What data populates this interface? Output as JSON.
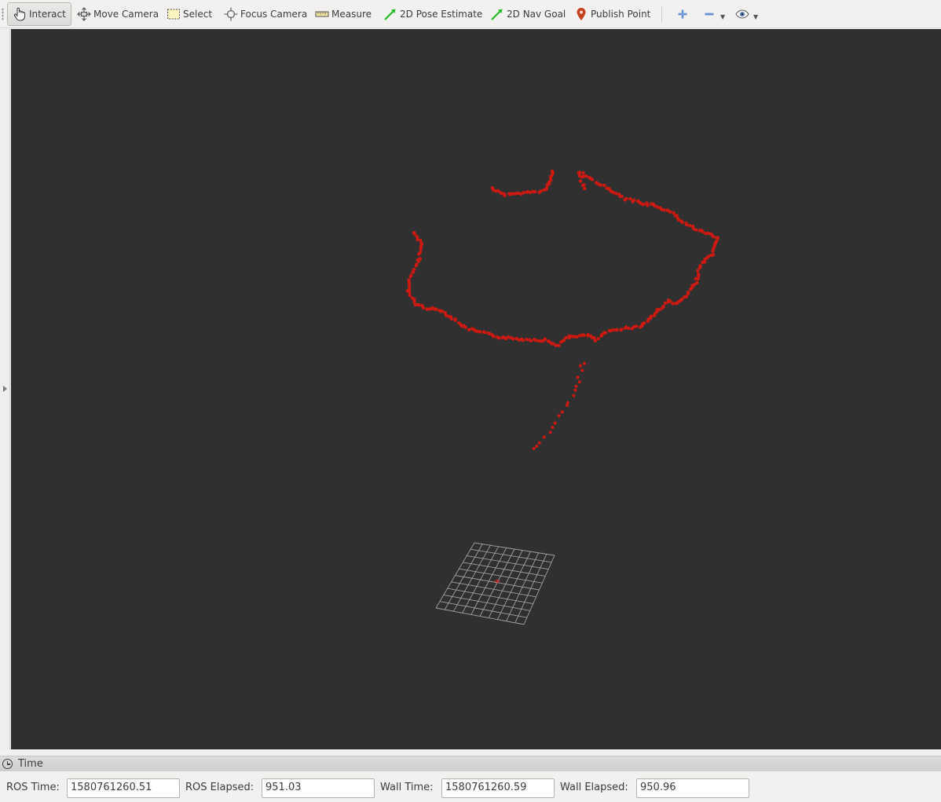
{
  "toolbar": {
    "tools": [
      {
        "label": "Interact",
        "icon": "hand-pointer-icon",
        "active": true
      },
      {
        "label": "Move Camera",
        "icon": "move-camera-icon"
      },
      {
        "label": "Select",
        "icon": "select-rectangle-icon"
      },
      {
        "label": "Focus Camera",
        "icon": "focus-camera-icon"
      },
      {
        "label": "Measure",
        "icon": "ruler-icon"
      },
      {
        "label": "2D Pose Estimate",
        "icon": "green-arrow-icon"
      },
      {
        "label": "2D Nav Goal",
        "icon": "green-arrow-icon"
      },
      {
        "label": "Publish Point",
        "icon": "map-pin-icon"
      }
    ],
    "extra_icons": [
      "add-tool-icon",
      "remove-tool-icon",
      "view-eye-icon"
    ]
  },
  "viewport": {
    "background": "#303030",
    "pointcloud_color": "#cc1a12",
    "grid_color": "#a0a0a0"
  },
  "time_panel": {
    "title": "Time",
    "ros_time_label": "ROS Time:",
    "ros_time_value": "1580761260.51",
    "ros_elapsed_label": "ROS Elapsed:",
    "ros_elapsed_value": "951.03",
    "wall_time_label": "Wall Time:",
    "wall_time_value": "1580761260.59",
    "wall_elapsed_label": "Wall Elapsed:",
    "wall_elapsed_value": "950.96"
  }
}
